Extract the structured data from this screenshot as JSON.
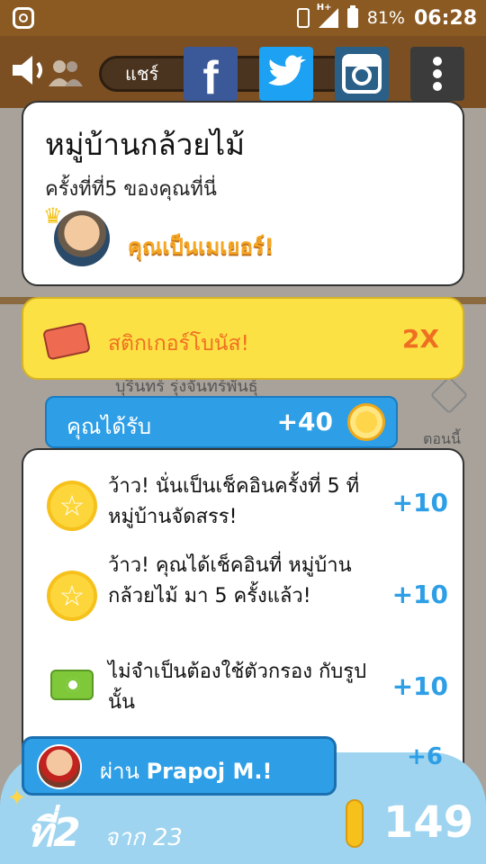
{
  "status_bar": {
    "battery": "81%",
    "time": "06:28",
    "network": "H+"
  },
  "toolbar": {
    "share_label": "แชร์",
    "icons": [
      "speaker-icon",
      "people-icon",
      "facebook-icon",
      "twitter-icon",
      "instagram-icon",
      "more-vertical-icon"
    ]
  },
  "background": {
    "user_name": "บุรินทร์ รุ่งจันทร์พันธุ์",
    "time_label": "ตอนนี้"
  },
  "mayor_card": {
    "venue": "หมู่บ้านกล้วยไม้",
    "visit_count": "ครั้งที่ที่5 ของคุณที่นี่",
    "mayor_text": "คุณเป็นเมเยอร์!"
  },
  "sticker_bonus": {
    "label": "สติกเกอร์โบนัส!",
    "multiplier": "2X"
  },
  "earned": {
    "label": "คุณได้รับ",
    "points": "+40"
  },
  "rewards": [
    {
      "icon": "star-badge-icon",
      "text": "ว้าว! นั่นเป็นเช็คอินครั้งที่ 5 ที่ หมู่บ้านจัดสรร!",
      "points": "+10"
    },
    {
      "icon": "star-badge-icon",
      "text": "ว้าว! คุณได้เช็คอินที่ หมู่บ้านกล้วยไม้ มา 5 ครั้งแล้ว!",
      "points": "+10"
    },
    {
      "icon": "camera-icon",
      "text": "ไม่จำเป็นต้องใช้ตัวกรอง กับรูปนั้น",
      "points": "+10"
    }
  ],
  "partial_points": "+6",
  "via": {
    "prefix": "ผ่าน",
    "name": "Prapoj M.!"
  },
  "footer": {
    "rank": "ที่2",
    "rank_of": "จาก 23",
    "coins": "149"
  },
  "colors": {
    "accent_blue": "#2e9fe6",
    "accent_yellow": "#fce144",
    "accent_orange": "#ef6f22",
    "toolbar_brown": "#7b4f22"
  }
}
